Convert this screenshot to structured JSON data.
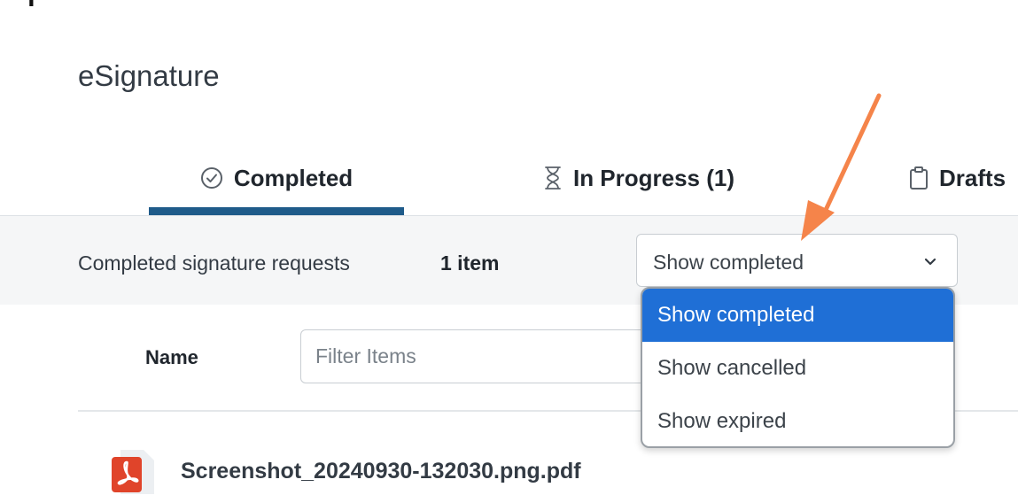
{
  "app": {
    "title": "eSignature"
  },
  "tabs": [
    {
      "label": "Completed",
      "icon": "check-circle-icon",
      "active": true
    },
    {
      "label": "In Progress (1)",
      "icon": "hourglass-icon",
      "active": false
    },
    {
      "label": "Drafts",
      "icon": "clipboard-icon",
      "active": false
    }
  ],
  "toolbar": {
    "label": "Completed signature requests",
    "count": "1 item",
    "select_value": "Show completed"
  },
  "dropdown": {
    "options": [
      "Show completed",
      "Show cancelled",
      "Show expired"
    ],
    "selected_index": 0
  },
  "list": {
    "name_header": "Name",
    "filter_placeholder": "Filter Items",
    "rows": [
      {
        "file_name": "Screenshot_20240930-132030.png.pdf",
        "icon": "pdf-file-icon"
      }
    ]
  },
  "colors": {
    "tab_underline": "#1f5b8a",
    "selected_option": "#1f6fd6",
    "annotation_arrow": "#f5844a",
    "pdf_icon": "#e0442a"
  }
}
